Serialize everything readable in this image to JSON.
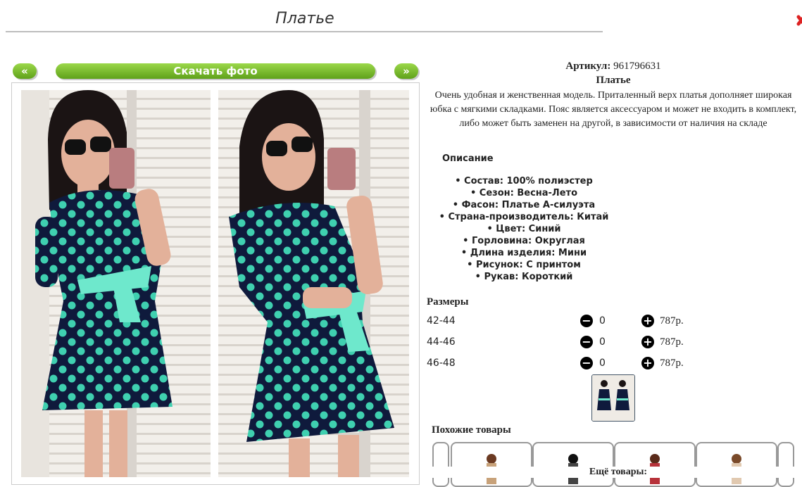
{
  "header": {
    "title": "Платье"
  },
  "gallery": {
    "prev_label": "«",
    "download_label": "Скачать фото",
    "next_label": "»"
  },
  "product": {
    "article_label": "Артикул:",
    "article_value": "961796631",
    "name": "Платье",
    "description": "Очень удобная и женственная модель. Приталенный верх платья дополняет широкая юбка с мягкими складками. Пояс является аксессуаром и может не входить в комплект, либо может быть заменен на другой, в зависимости от наличия на складе",
    "specs_heading": "Описание",
    "specs": [
      "• Состав: 100% полиэстер",
      "• Сезон: Весна-Лето",
      "• Фасон: Платье А-силуэта",
      "• Страна-производитель: Китай",
      "• Цвет: Синий",
      "• Горловина: Округлая",
      "• Длина изделия: Мини",
      "• Рисунок: С принтом",
      "• Рукав: Короткий"
    ]
  },
  "sizes": {
    "heading": "Размеры",
    "rows": [
      {
        "size": "42-44",
        "qty": "0",
        "price": "787р."
      },
      {
        "size": "44-46",
        "qty": "0",
        "price": "787р."
      },
      {
        "size": "46-48",
        "qty": "0",
        "price": "787р."
      }
    ]
  },
  "similar": {
    "heading": "Похожие товары"
  },
  "more": {
    "heading": "Ещё товары:"
  },
  "colors": {
    "accent_green": "#6fb524",
    "dress_navy": "#0f1a3c",
    "dot_mint": "#3fd0b0"
  }
}
